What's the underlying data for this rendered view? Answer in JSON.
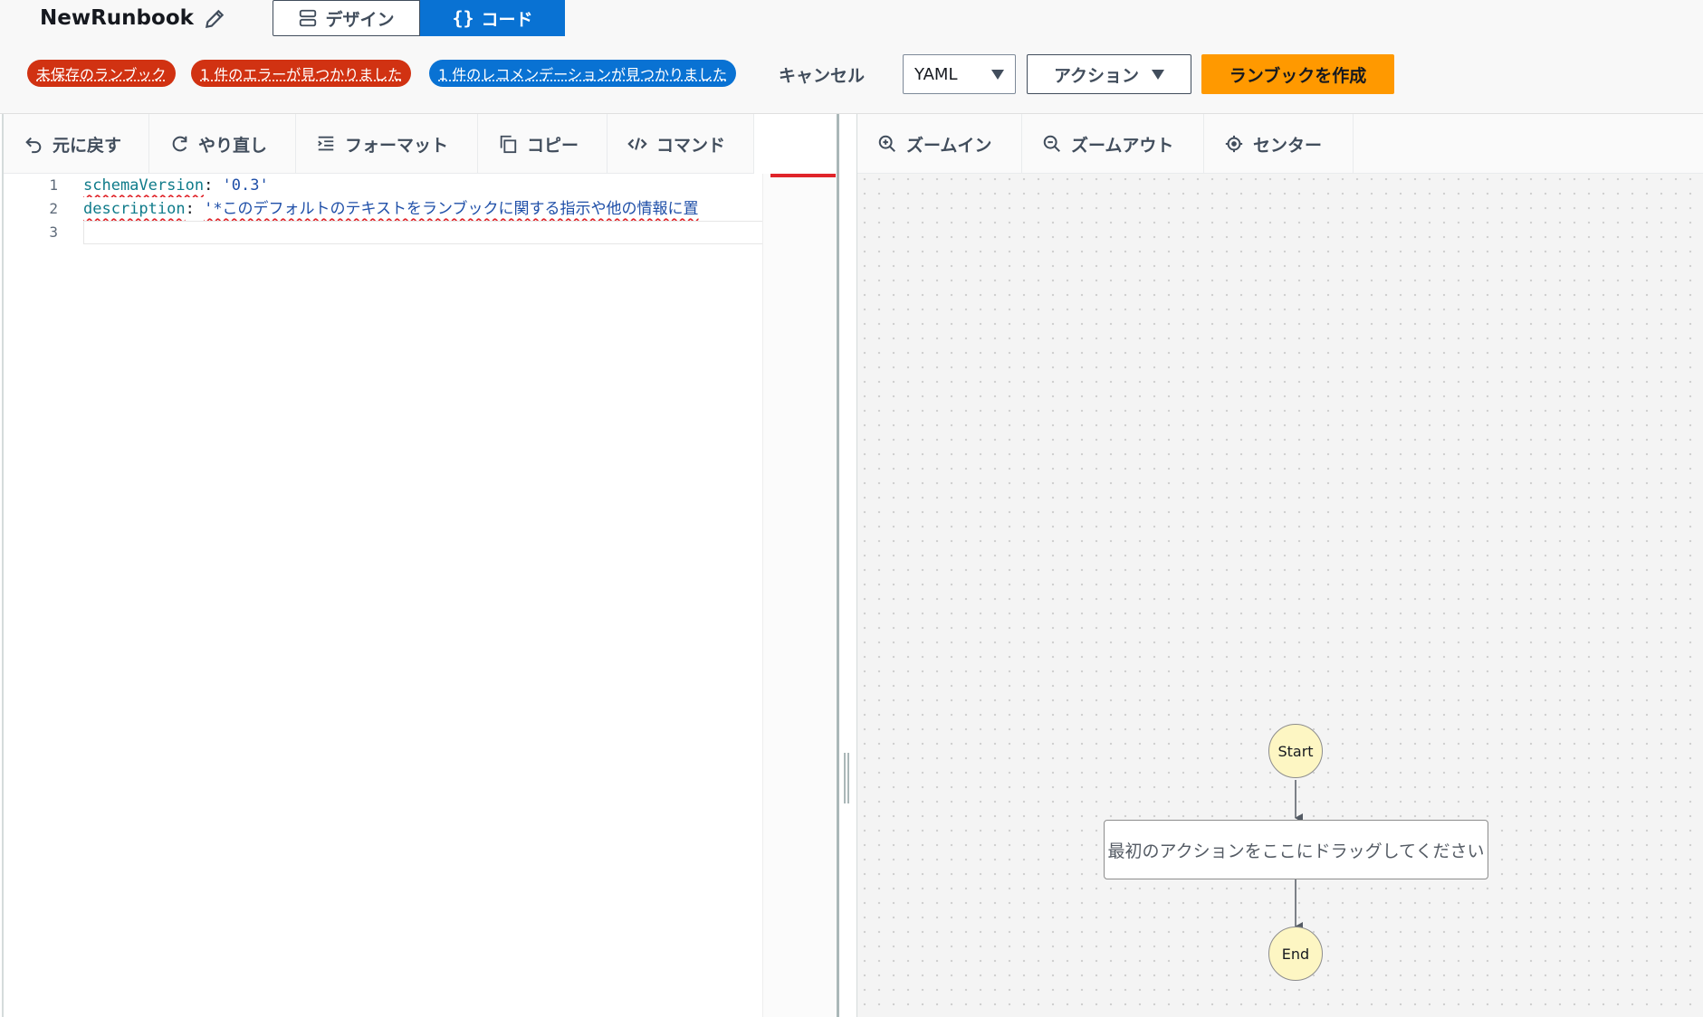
{
  "header": {
    "title": "NewRunbook",
    "tabs": [
      {
        "label": "デザイン",
        "icon": "design-icon",
        "selected": false
      },
      {
        "label": "コード",
        "icon": "code-braces-icon",
        "selected": true
      }
    ],
    "badges": [
      {
        "label": "未保存のランブック",
        "color": "#d13212"
      },
      {
        "label": "1 件のエラーが見つかりました",
        "color": "#d13212"
      },
      {
        "label": "1 件のレコメンデーションが見つかりました",
        "color": "#0972d3"
      }
    ],
    "cancel_label": "キャンセル",
    "format_select": {
      "value": "YAML"
    },
    "actions_label": "アクション",
    "create_label": "ランブックを作成",
    "colors": {
      "primary": "#ff9900",
      "selected_tab": "#0972d3"
    }
  },
  "editor_toolbar": [
    {
      "label": "元に戻す",
      "icon": "undo-icon"
    },
    {
      "label": "やり直し",
      "icon": "redo-icon"
    },
    {
      "label": "フォーマット",
      "icon": "format-icon"
    },
    {
      "label": "コピー",
      "icon": "copy-icon"
    },
    {
      "label": "コマンド",
      "icon": "command-icon"
    }
  ],
  "editor": {
    "line_numbers": [
      "1",
      "2",
      "3"
    ],
    "lines": [
      {
        "key": "schemaVersion",
        "sep": ": ",
        "value": "'0.3'"
      },
      {
        "key": "description",
        "sep": ": ",
        "value": "'*このデフォルトのテキストをランブックに関する指示や他の情報に置"
      },
      {
        "key": "",
        "sep": "",
        "value": ""
      }
    ]
  },
  "canvas_toolbar": [
    {
      "label": "ズームイン",
      "icon": "zoom-in-icon"
    },
    {
      "label": "ズームアウト",
      "icon": "zoom-out-icon"
    },
    {
      "label": "センター",
      "icon": "center-icon"
    }
  ],
  "canvas": {
    "start_label": "Start",
    "placeholder_label": "最初のアクションをここにドラッグしてください",
    "end_label": "End"
  }
}
